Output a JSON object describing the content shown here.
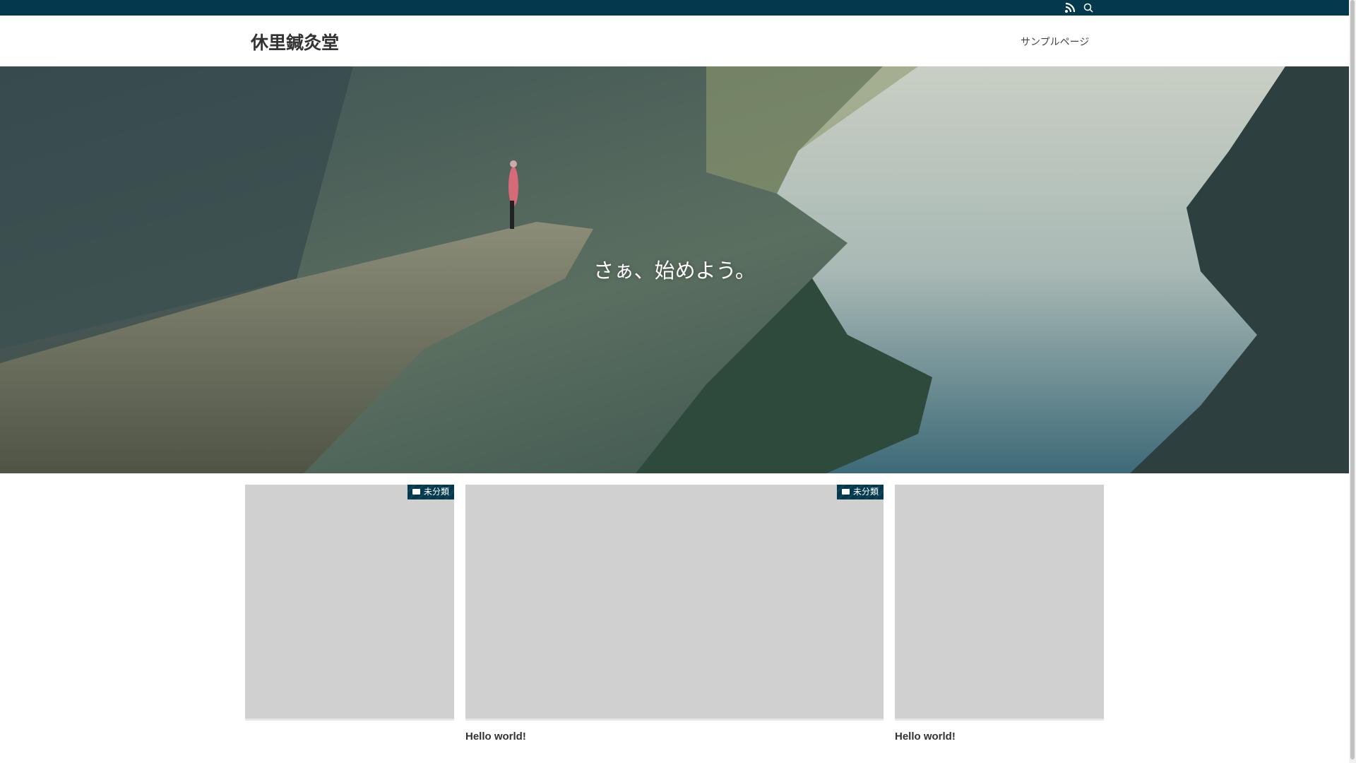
{
  "header": {
    "site_title": "休里鍼灸堂",
    "nav": [
      {
        "label": "サンプルページ"
      }
    ],
    "icons": [
      "rss-icon",
      "search-icon"
    ]
  },
  "hero": {
    "text": "さぁ、始めよう。"
  },
  "cards": [
    {
      "category": "未分類",
      "title": ""
    },
    {
      "category": "未分類",
      "title": "Hello world!"
    },
    {
      "category": "",
      "title": "Hello world!"
    }
  ],
  "colors": {
    "topbar": "#04384c",
    "placeholder": "#d0d0d0"
  }
}
